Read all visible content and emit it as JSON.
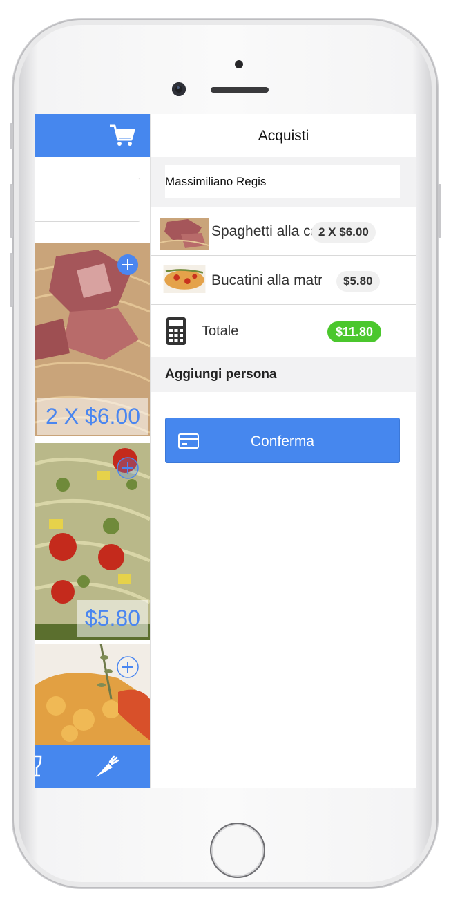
{
  "menu": {
    "cart_icon": "shopping-cart-icon",
    "items": [
      {
        "price_label": "2 X $6.00",
        "add_icon": "plus-circle-icon"
      },
      {
        "price_label": "$5.80",
        "add_icon": "plus-circle-icon"
      },
      {
        "price_label": "",
        "add_icon": "plus-circle-icon"
      }
    ],
    "footer_icons": [
      "wine-glass-icon",
      "carrot-icon"
    ]
  },
  "cart": {
    "title": "Acquisti",
    "customer_name": "Massimiliano Regis",
    "items": [
      {
        "name": "Spaghetti alla carbonara",
        "qty_price": "2 X $6.00"
      },
      {
        "name": "Bucatini alla matriciana",
        "qty_price": "$5.80"
      }
    ],
    "total_label": "Totale",
    "total_value": "$11.80",
    "add_person_label": "Aggiungi persona",
    "confirm_label": "Conferma",
    "colors": {
      "accent": "#4687ee",
      "total_badge": "#4bc72d"
    }
  }
}
